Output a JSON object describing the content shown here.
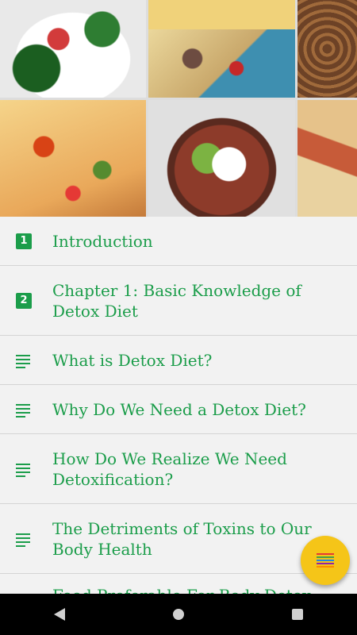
{
  "header": {
    "image_description_icon": "food-collage"
  },
  "list": {
    "items": [
      {
        "type": "number",
        "badge": "1",
        "label": "Introduction"
      },
      {
        "type": "number",
        "badge": "2",
        "label": "Chapter 1: Basic Knowledge of Detox Diet"
      },
      {
        "type": "text",
        "label": "What is Detox Diet?"
      },
      {
        "type": "text",
        "label": "Why Do We Need a Detox Diet?"
      },
      {
        "type": "text",
        "label": "How Do We Realize We Need Detoxification?"
      },
      {
        "type": "text",
        "label": "The Detriments of Toxins to Our Body Health"
      },
      {
        "type": "text",
        "label": "Food Preferable For Body Detox Effect"
      }
    ]
  },
  "colors": {
    "accent": "#1b9d4a",
    "fab": "#f5c518",
    "fab_lines": [
      "#e53935",
      "#43a047",
      "#1e88e5",
      "#8e24aa",
      "#fb8c00"
    ]
  },
  "fab": {
    "icon": "menu-lines-icon"
  },
  "navbar": {
    "back_icon": "back-icon",
    "home_icon": "home-icon",
    "recents_icon": "recents-icon"
  }
}
